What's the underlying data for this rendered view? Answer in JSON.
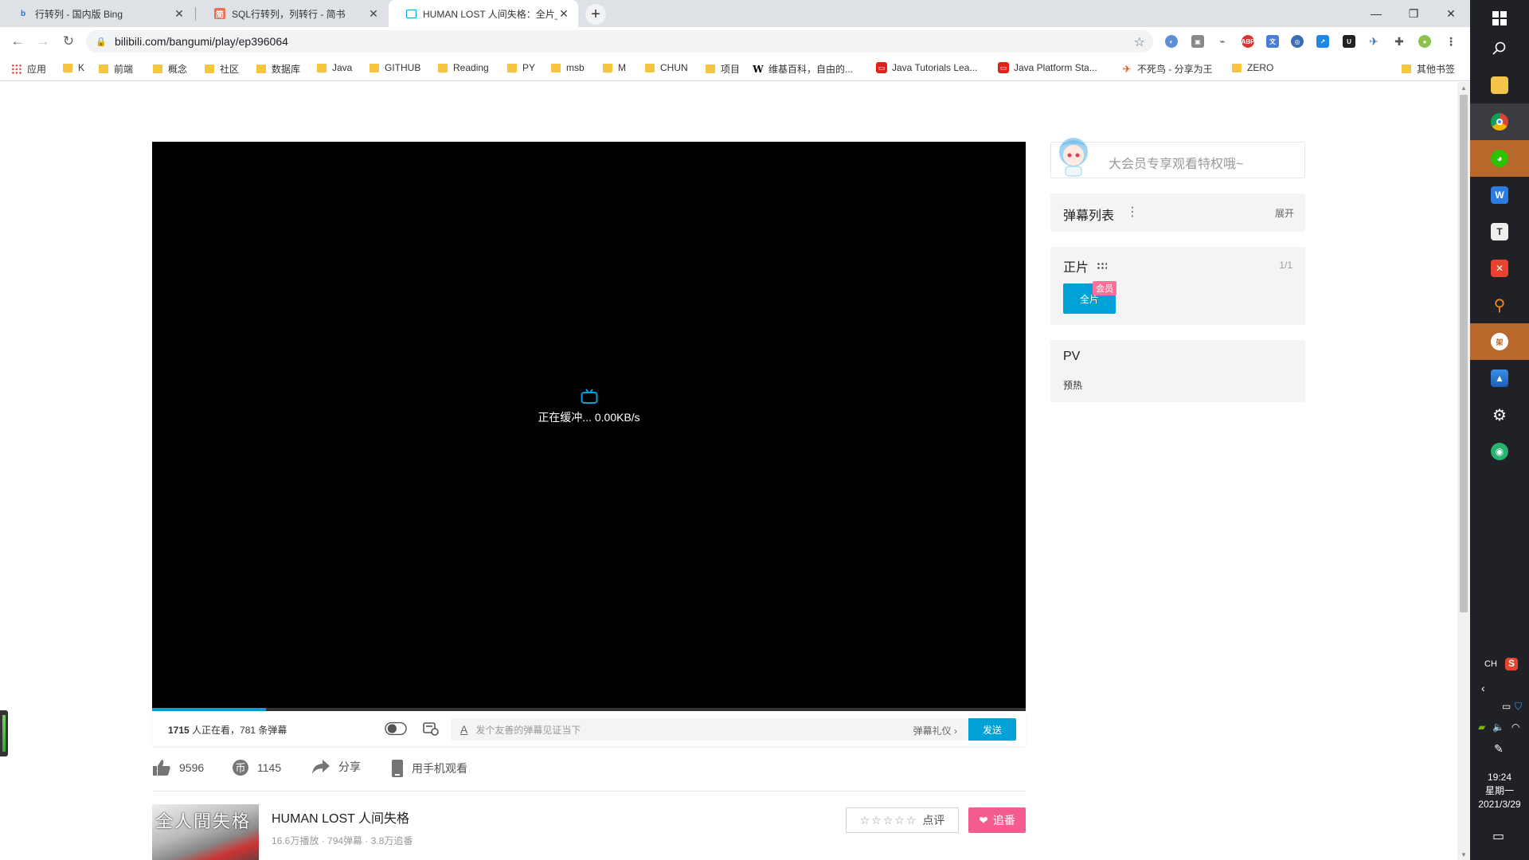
{
  "browser": {
    "tabs": [
      {
        "title": "行转列 - 国内版 Bing",
        "icon": "bing-icon",
        "color": "#1a73e8",
        "glyph": "b"
      },
      {
        "title": "SQL行转列，列转行 - 简书",
        "icon": "jianshu-icon",
        "color": "#ea6f5a",
        "glyph": "简"
      },
      {
        "title": "HUMAN LOST 人间失格：全片_",
        "icon": "bilibili-icon",
        "color": "#00a1d6",
        "glyph": "▢"
      }
    ],
    "url": "bilibili.com/bangumi/play/ep396064",
    "bookmarks": [
      {
        "label": "应用",
        "type": "apps"
      },
      {
        "label": "K",
        "type": "folder"
      },
      {
        "label": "前端",
        "type": "folder"
      },
      {
        "label": "概念",
        "type": "folder"
      },
      {
        "label": "社区",
        "type": "folder"
      },
      {
        "label": "数据库",
        "type": "folder"
      },
      {
        "label": "Java",
        "type": "folder"
      },
      {
        "label": "GITHUB",
        "type": "folder"
      },
      {
        "label": "Reading",
        "type": "folder"
      },
      {
        "label": "PY",
        "type": "folder"
      },
      {
        "label": "msb",
        "type": "folder"
      },
      {
        "label": "M",
        "type": "folder"
      },
      {
        "label": "CHUN",
        "type": "folder"
      },
      {
        "label": "项目",
        "type": "folder"
      },
      {
        "label": "维基百科，自由的...",
        "type": "wiki"
      },
      {
        "label": "Java Tutorials Lea...",
        "type": "oracle"
      },
      {
        "label": "Java Platform Sta...",
        "type": "oracle"
      },
      {
        "label": "不死鸟 - 分享为王",
        "type": "bird"
      },
      {
        "label": "ZERO",
        "type": "folder"
      }
    ],
    "other_bookmarks": "其他书签"
  },
  "player": {
    "buffering_text": "正在缓冲... 0.00KB/s",
    "progress_fraction": 0.13,
    "viewers_count": "1715",
    "viewers_suffix": " 人正在看，",
    "danmaku_count": "781",
    "danmaku_suffix": " 条弹幕",
    "danmaku_placeholder": "发个友善的弹幕见证当下",
    "etiquette": "弹幕礼仪 ›",
    "send_label": "发送"
  },
  "actions": {
    "like_count": "9596",
    "coin_count": "1145",
    "share_label": "分享",
    "mobile_label": "用手机观看"
  },
  "media": {
    "cover_text": "全人間失格",
    "title": "HUMAN LOST 人间失格",
    "stats": "16.6万播放 · 794弹幕 · 3.8万追番",
    "rate_stars": "☆☆☆☆☆",
    "rate_label": "点评",
    "follow_label": "追番"
  },
  "sidebar": {
    "vip_text": "大会员专享观看特权哦~",
    "danmaku_list_title": "弹幕列表",
    "danmaku_list_more": "⋮",
    "danmaku_list_expand": "展开",
    "episodes_title": "正片",
    "episodes_count": "1/1",
    "episode_label": "全片",
    "episode_badge": "会员",
    "pv_title": "PV",
    "pv_item": "预热"
  },
  "taskbar": {
    "lang": "CH",
    "time": "19:24",
    "weekday": "星期一",
    "date": "2021/3/29"
  },
  "colors": {
    "accent": "#00a1d6",
    "pink": "#f25d8e",
    "badge": "#fb7299"
  }
}
